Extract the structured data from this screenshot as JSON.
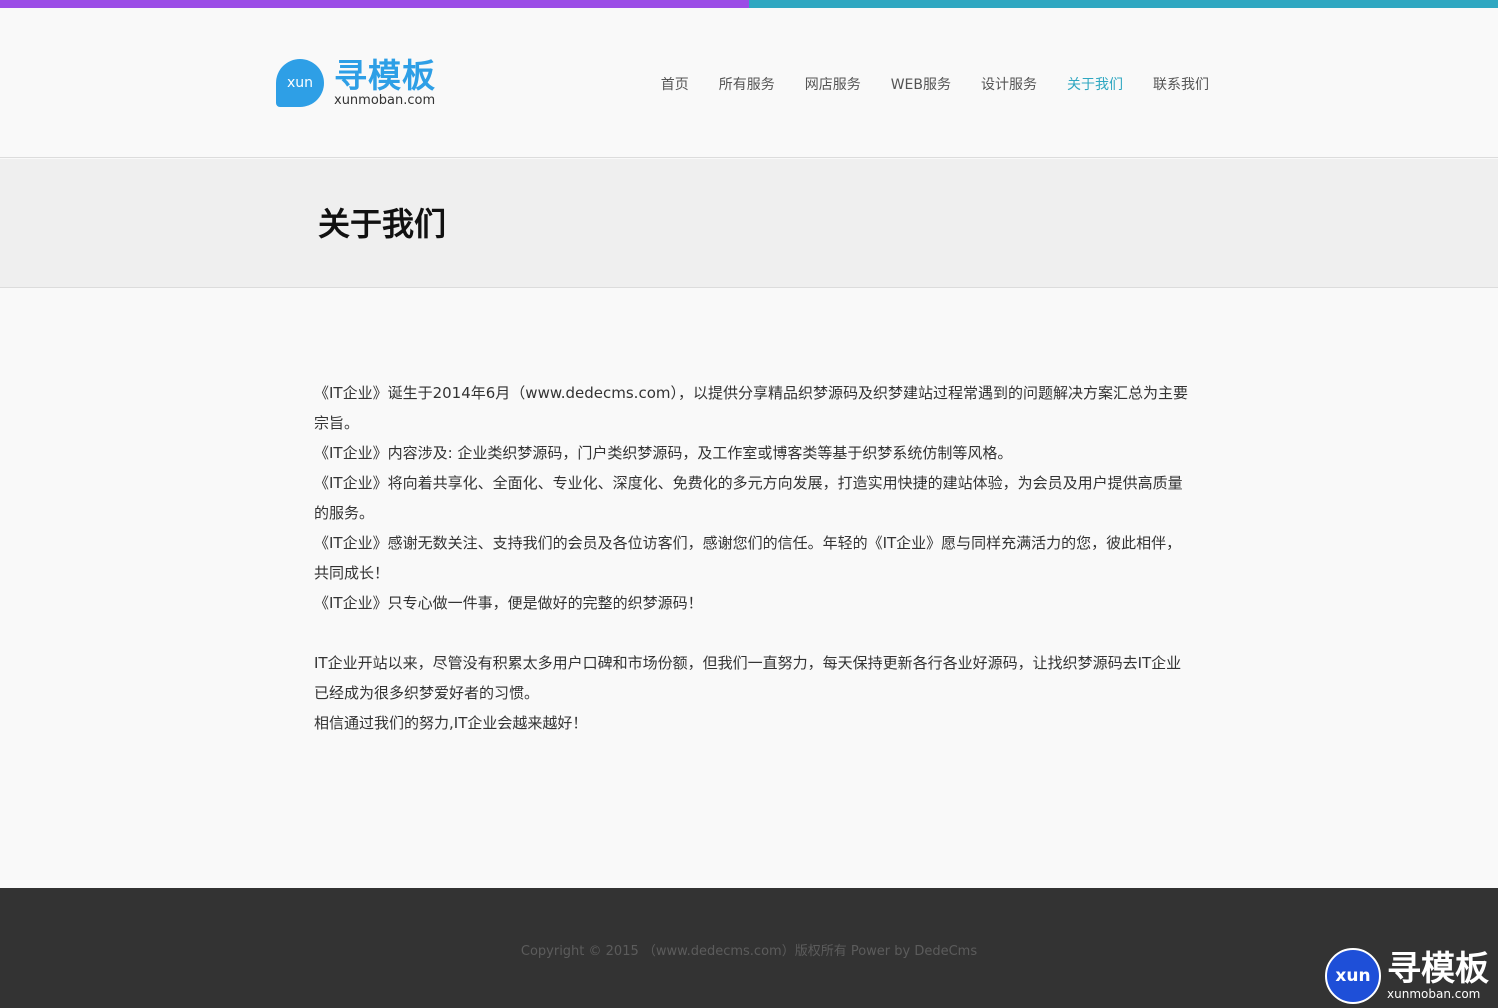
{
  "colors": {
    "top_bar_left": "#9b4de6",
    "top_bar_right": "#2fa7c1",
    "accent": "#2fa7c1",
    "logo_blue": "#2e9fe6",
    "watermark_blue": "#1e4fd8"
  },
  "header": {
    "logo": {
      "badge": "xun",
      "name": "寻模板",
      "url": "xunmoban.com"
    },
    "nav": [
      {
        "label": "首页",
        "active": false
      },
      {
        "label": "所有服务",
        "active": false
      },
      {
        "label": "网店服务",
        "active": false
      },
      {
        "label": "WEB服务",
        "active": false
      },
      {
        "label": "设计服务",
        "active": false
      },
      {
        "label": "关于我们",
        "active": true
      },
      {
        "label": "联系我们",
        "active": false
      }
    ]
  },
  "banner": {
    "title": "关于我们"
  },
  "content": {
    "paragraphs": [
      "《IT企业》诞生于2014年6月（www.dedecms.com），以提供分享精品织梦源码及织梦建站过程常遇到的问题解决方案汇总为主要宗旨。",
      "《IT企业》内容涉及: 企业类织梦源码，门户类织梦源码，及工作室或博客类等基于织梦系统仿制等风格。",
      "《IT企业》将向着共享化、全面化、专业化、深度化、免费化的多元方向发展，打造实用快捷的建站体验，为会员及用户提供高质量的服务。",
      "《IT企业》感谢无数关注、支持我们的会员及各位访客们，感谢您们的信任。年轻的《IT企业》愿与同样充满活力的您，彼此相伴，共同成长！",
      "《IT企业》只专心做一件事，便是做好的完整的织梦源码！",
      "IT企业开站以来，尽管没有积累太多用户口碑和市场份额，但我们一直努力，每天保持更新各行各业好源码，让找织梦源码去IT企业已经成为很多织梦爱好者的习惯。",
      "相信通过我们的努力,IT企业会越来越好！"
    ]
  },
  "footer": {
    "copyright": "Copyright © 2015 （www.dedecms.com）版权所有 Power by DedeCms"
  },
  "watermark": {
    "badge": "xun",
    "name": "寻模板",
    "url": "xunmoban.com"
  }
}
